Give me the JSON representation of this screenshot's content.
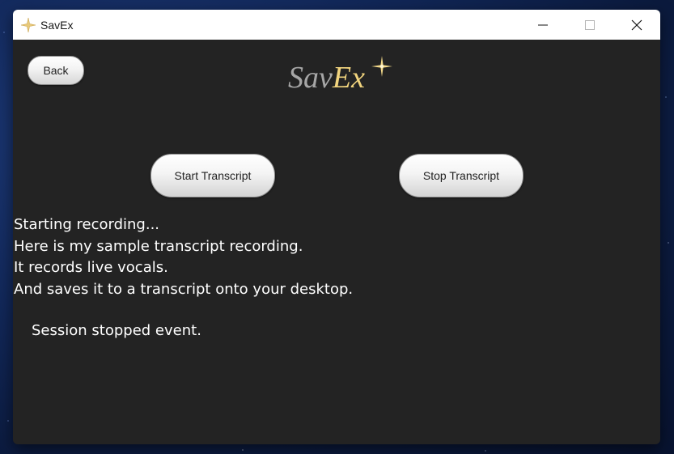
{
  "window": {
    "title": "SavEx",
    "controls": [
      "minimize-icon",
      "maximize-icon",
      "close-icon"
    ]
  },
  "toolbar": {
    "back_label": "Back"
  },
  "logo": {
    "part1": "Sav",
    "part2": "Ex",
    "icon": "sparkle-star-icon",
    "colors": {
      "part1": "#a6a6a6",
      "part2": "#f1d47e"
    }
  },
  "controls": {
    "start_label": "Start Transcript",
    "stop_label": "Stop Transcript"
  },
  "transcript": {
    "lines": [
      "Starting recording...",
      "Here is my sample transcript recording.",
      "It records live vocals.",
      "And saves it to a transcript onto your desktop."
    ]
  },
  "status": {
    "text": "Session stopped event."
  },
  "theme": {
    "background": "#232323",
    "text": "#ffffff",
    "titlebar": "#ffffff"
  }
}
